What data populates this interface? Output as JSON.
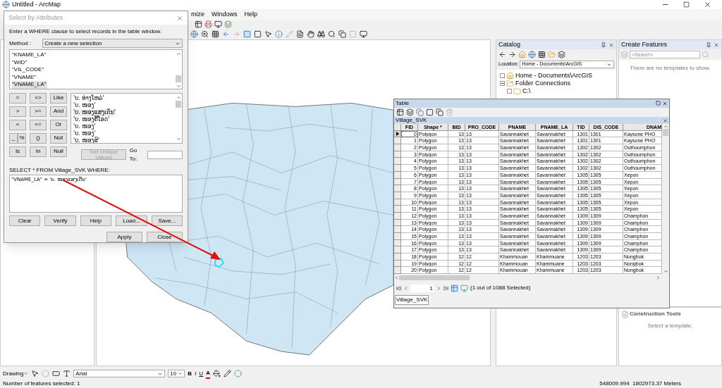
{
  "window": {
    "title": "Untitled - ArcMap"
  },
  "menu": [
    "mize",
    "Windows",
    "Help"
  ],
  "dialog": {
    "title": "Select by Attributes",
    "instruction": "Enter a WHERE clause to select records in the table window.",
    "method_label": "Method :",
    "method": "Create a new selection",
    "fields": [
      {
        "label": "\"KNAME_LA\"",
        "selected": false
      },
      {
        "label": "\"WID\"",
        "selected": false
      },
      {
        "label": "\"VIL_CODE\"",
        "selected": false
      },
      {
        "label": "\"VNAME\"",
        "selected": false
      },
      {
        "label": "\"VNAME_LA\"",
        "selected": true
      }
    ],
    "operators": [
      [
        "=",
        "<>",
        "Like"
      ],
      [
        ">",
        ">=",
        "And"
      ],
      [
        "<",
        "<=",
        "Or"
      ],
      [
        "_",
        "%",
        "()",
        "Not"
      ],
      [
        "Is",
        "In",
        "Null"
      ]
    ],
    "values": [
      {
        "label": "'ບ. ທ່າງໂຫລ່'",
        "selected": false
      },
      {
        "label": "'ບ. ໜອງ'",
        "selected": false
      },
      {
        "label": "'ບ. ໜອງແສງເດັ່ນ'",
        "selected": true
      },
      {
        "label": "'ບ. ໜອງຄີ້ໂອດ'",
        "selected": false
      },
      {
        "label": "'ບ. ໜອງ'",
        "selected": false
      },
      {
        "label": "'ບ. ໜອງ'",
        "selected": false
      },
      {
        "label": "'ບ. ໜອງສົ'",
        "selected": false
      }
    ],
    "unique_button": {
      "label": "Get Unique Values",
      "disabled": true
    },
    "goto_label": "Go To:",
    "select_label": "SELECT * FROM Village_SVK WHERE:",
    "expression": "\"VNAME_LA\" = 'ບ. ໜອງແສງເດັ່ນ'",
    "buttons_row1": [
      "Clear",
      "Verify",
      "Help",
      "Load...",
      "Save..."
    ],
    "buttons_row2": [
      "Apply",
      "Close"
    ]
  },
  "table_window": {
    "title": "Table",
    "layer_tab": "Village_SVK",
    "columns": [
      "FID",
      "Shape *",
      "BID",
      "PRO_CODE",
      "PNAME",
      "PNAME_LA",
      "TID",
      "DIS_CODE",
      "DNAM"
    ],
    "rows": [
      {
        "current": true,
        "cells": [
          "0",
          "Polygon",
          "13",
          "13",
          "Savannakhet",
          "Savannakhet",
          "1301",
          "1301",
          "Kaysone PHO"
        ]
      },
      {
        "current": false,
        "cells": [
          "1",
          "Polygon",
          "13",
          "13",
          "Savannakhet",
          "Savannakhet",
          "1301",
          "1301",
          "Kaysone PHO"
        ]
      },
      {
        "current": false,
        "cells": [
          "2",
          "Polygon",
          "13",
          "13",
          "Savannakhet",
          "Savannakhet",
          "1302",
          "1302",
          "Outhoumphon"
        ]
      },
      {
        "current": false,
        "cells": [
          "3",
          "Polygon",
          "13",
          "13",
          "Savannakhet",
          "Savannakhet",
          "1302",
          "1302",
          "Outhoumphon"
        ]
      },
      {
        "current": false,
        "cells": [
          "4",
          "Polygon",
          "13",
          "13",
          "Savannakhet",
          "Savannakhet",
          "1302",
          "1302",
          "Outhoumphon"
        ]
      },
      {
        "current": false,
        "cells": [
          "5",
          "Polygon",
          "13",
          "13",
          "Savannakhet",
          "Savannakhet",
          "1302",
          "1302",
          "Outhoumphon"
        ]
      },
      {
        "current": false,
        "cells": [
          "6",
          "Polygon",
          "13",
          "13",
          "Savannakhet",
          "Savannakhet",
          "1305",
          "1305",
          "Xepon"
        ]
      },
      {
        "current": false,
        "cells": [
          "7",
          "Polygon",
          "13",
          "13",
          "Savannakhet",
          "Savannakhet",
          "1305",
          "1305",
          "Xepon"
        ]
      },
      {
        "current": false,
        "cells": [
          "8",
          "Polygon",
          "13",
          "13",
          "Savannakhet",
          "Savannakhet",
          "1305",
          "1305",
          "Xepon"
        ]
      },
      {
        "current": false,
        "cells": [
          "9",
          "Polygon",
          "13",
          "13",
          "Savannakhet",
          "Savannakhet",
          "1305",
          "1305",
          "Xepon"
        ]
      },
      {
        "current": false,
        "cells": [
          "10",
          "Polygon",
          "13",
          "13",
          "Savannakhet",
          "Savannakhet",
          "1305",
          "1305",
          "Xepon"
        ]
      },
      {
        "current": false,
        "cells": [
          "11",
          "Polygon",
          "13",
          "13",
          "Savannakhet",
          "Savannakhet",
          "1305",
          "1305",
          "Xepon"
        ]
      },
      {
        "current": false,
        "cells": [
          "12",
          "Polygon",
          "13",
          "13",
          "Savannakhet",
          "Savannakhet",
          "1309",
          "1309",
          "Champhon"
        ]
      },
      {
        "current": false,
        "cells": [
          "13",
          "Polygon",
          "13",
          "13",
          "Savannakhet",
          "Savannakhet",
          "1309",
          "1309",
          "Champhon"
        ]
      },
      {
        "current": false,
        "cells": [
          "14",
          "Polygon",
          "13",
          "13",
          "Savannakhet",
          "Savannakhet",
          "1309",
          "1309",
          "Champhon"
        ]
      },
      {
        "current": false,
        "cells": [
          "15",
          "Polygon",
          "13",
          "13",
          "Savannakhet",
          "Savannakhet",
          "1309",
          "1309",
          "Champhon"
        ]
      },
      {
        "current": false,
        "cells": [
          "16",
          "Polygon",
          "13",
          "13",
          "Savannakhet",
          "Savannakhet",
          "1309",
          "1309",
          "Champhon"
        ]
      },
      {
        "current": false,
        "cells": [
          "17",
          "Polygon",
          "13",
          "13",
          "Savannakhet",
          "Savannakhet",
          "1309",
          "1309",
          "Champhon"
        ]
      },
      {
        "current": false,
        "cells": [
          "18",
          "Polygon",
          "12",
          "12",
          "Khammouan",
          "Khammuane",
          "1203",
          "1203",
          "Nongbok"
        ]
      },
      {
        "current": false,
        "cells": [
          "19",
          "Polygon",
          "12",
          "12",
          "Khammouan",
          "Khammuane",
          "1203",
          "1203",
          "Nongbok"
        ]
      },
      {
        "current": false,
        "cells": [
          "20",
          "Polygon",
          "12",
          "12",
          "Khammouan",
          "Khammuane",
          "1203",
          "1203",
          "Nongbok"
        ]
      }
    ],
    "record": "1",
    "selection_info": "(1 out of 1088 Selected)",
    "bottom_tab": "Village_SVK"
  },
  "catalog": {
    "title": "Catalog",
    "location_label": "Location:",
    "location": "Home - Documents\\ArcGIS",
    "tree": [
      {
        "label": "Home - Documents\\ArcGIS",
        "expanded": false
      },
      {
        "label": "Folder Connections",
        "expanded": true,
        "children": [
          {
            "label": "C:\\",
            "expanded": false
          }
        ]
      }
    ]
  },
  "create_features": {
    "title": "Create Features",
    "search_placeholder": "<Search>",
    "message": "There are no templates to show."
  },
  "construction_tools": {
    "title": "Construction Tools",
    "message": "Select a template."
  },
  "drawing_toolbar": {
    "drawing_label": "Drawing",
    "font": "Arial",
    "size": "10",
    "bold": "B",
    "italic": "I",
    "underline": "U",
    "font_color": "A"
  },
  "status_bar": {
    "message": "Number of features selected: 1",
    "coordinates": "548009.994  1802973.37 Meters"
  }
}
